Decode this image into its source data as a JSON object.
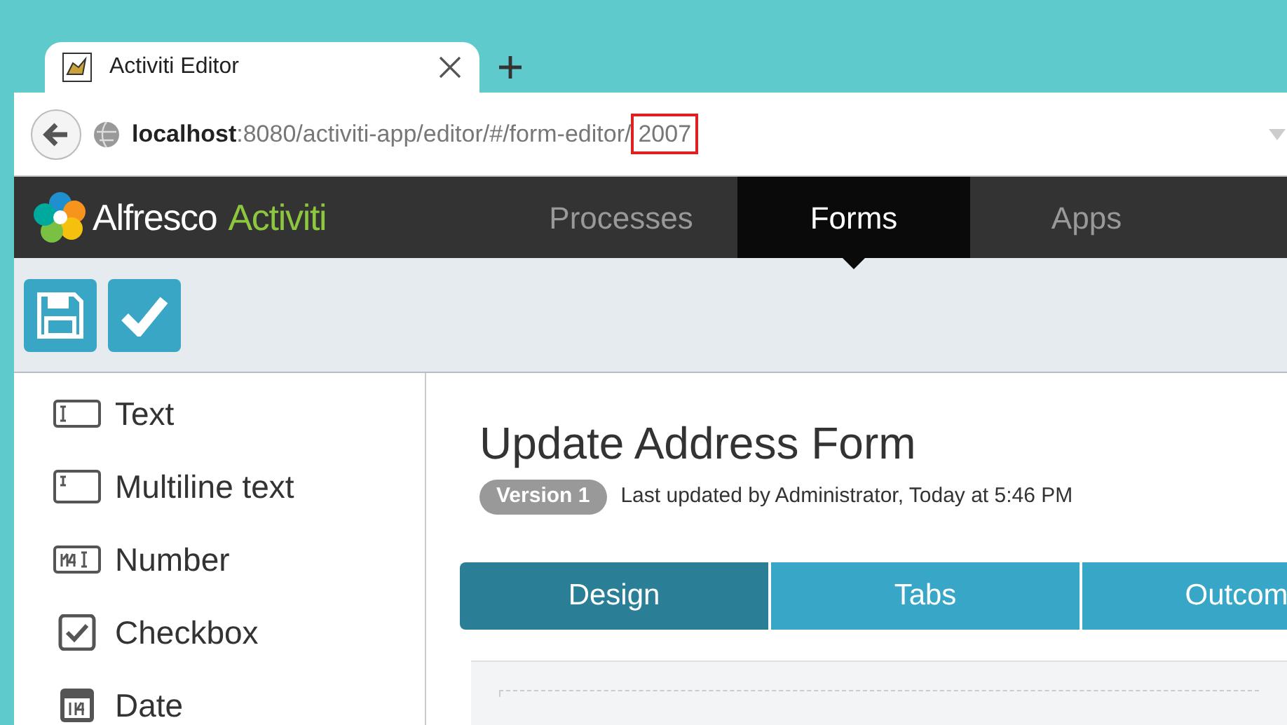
{
  "browser": {
    "tab_title": "Activiti Editor",
    "url": {
      "host": "localhost",
      "path": ":8080/activiti-app/editor/#/form-editor/",
      "highlighted": "2007"
    }
  },
  "app": {
    "logo_left": "Alfresco",
    "logo_right": "Activiti",
    "nav": [
      {
        "label": "Processes",
        "selected": false
      },
      {
        "label": "Forms",
        "selected": true
      },
      {
        "label": "Apps",
        "selected": false
      }
    ]
  },
  "palette": [
    {
      "kind": "text",
      "label": "Text"
    },
    {
      "kind": "multiline",
      "label": "Multiline text"
    },
    {
      "kind": "number",
      "label": "Number"
    },
    {
      "kind": "checkbox",
      "label": "Checkbox"
    },
    {
      "kind": "date",
      "label": "Date"
    }
  ],
  "form": {
    "title": "Update Address Form",
    "version": "Version 1",
    "updated": "Last updated by Administrator, Today at 5:46 PM",
    "tabs": [
      {
        "label": "Design",
        "selected": true
      },
      {
        "label": "Tabs",
        "selected": false
      },
      {
        "label": "Outcom",
        "selected": false
      }
    ]
  }
}
